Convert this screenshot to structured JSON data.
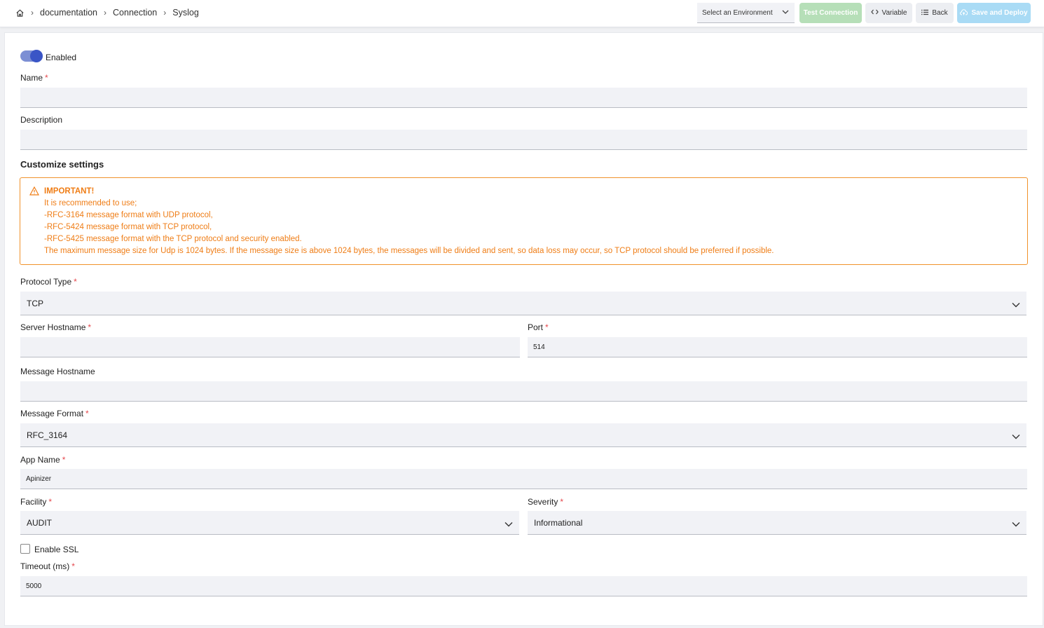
{
  "breadcrumb": {
    "items": [
      "documentation",
      "Connection",
      "Syslog"
    ]
  },
  "toolbar": {
    "environment_placeholder": "Select an Environment",
    "test_connection": "Test Connection",
    "variable": "Variable",
    "back": "Back",
    "save_deploy": "Save and Deploy"
  },
  "form": {
    "enabled_label": "Enabled",
    "name_label": "Name",
    "name_value": "",
    "description_label": "Description",
    "description_value": "",
    "section_title": "Customize settings",
    "alert": {
      "title": "IMPORTANT!",
      "lines": [
        "It is recommended to use;",
        "-RFC-3164 message format with UDP protocol,",
        "-RFC-5424 message format with TCP protocol,",
        "-RFC-5425 message format with the TCP protocol and security enabled.",
        "The maximum message size for Udp is 1024 bytes. If the message size is above 1024 bytes, the messages will be divided and sent, so data loss may occur, so TCP protocol should be preferred if possible."
      ]
    },
    "protocol_label": "Protocol Type",
    "protocol_value": "TCP",
    "server_hostname_label": "Server Hostname",
    "server_hostname_value": "",
    "port_label": "Port",
    "port_value": "514",
    "message_hostname_label": "Message Hostname",
    "message_hostname_value": "",
    "message_format_label": "Message Format",
    "message_format_value": "RFC_3164",
    "app_name_label": "App Name",
    "app_name_value": "Apinizer",
    "facility_label": "Facility",
    "facility_value": "AUDIT",
    "severity_label": "Severity",
    "severity_value": "Informational",
    "enable_ssl_label": "Enable SSL",
    "timeout_label": "Timeout (ms)",
    "timeout_value": "5000"
  },
  "colors": {
    "warning": "#ef7d16",
    "toggle": "#3a55c6",
    "required": "#e5484d"
  }
}
